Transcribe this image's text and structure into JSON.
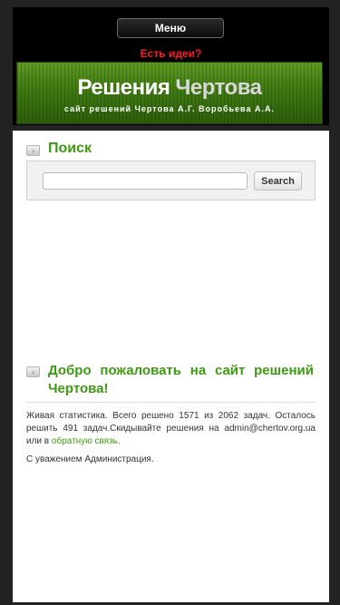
{
  "header": {
    "menu_label": "Меню",
    "ideas_link": "Есть идеи?",
    "banner_title_1": "Решения",
    "banner_title_2": "Чертова",
    "banner_subtitle": "сайт решений Чертова А.Г. Воробьева А.А."
  },
  "search": {
    "title": "Поиск",
    "input_value": "",
    "button_label": "Search"
  },
  "welcome": {
    "title": "Добро пожаловать на сайт решений Чертова!",
    "stats_text": "Живая статистика. Всего решено 1571 из 2062 задач. Осталось решить 491 задач.Скидывайте решения на admin@chertov.org.ua или в ",
    "feedback_link": "обратную связь",
    "stats_end": ".",
    "signature": "С уважением Администрация."
  },
  "colors": {
    "accent_green": "#3d9a10",
    "ideas_red": "#ff1a1a",
    "background": "#222222"
  }
}
